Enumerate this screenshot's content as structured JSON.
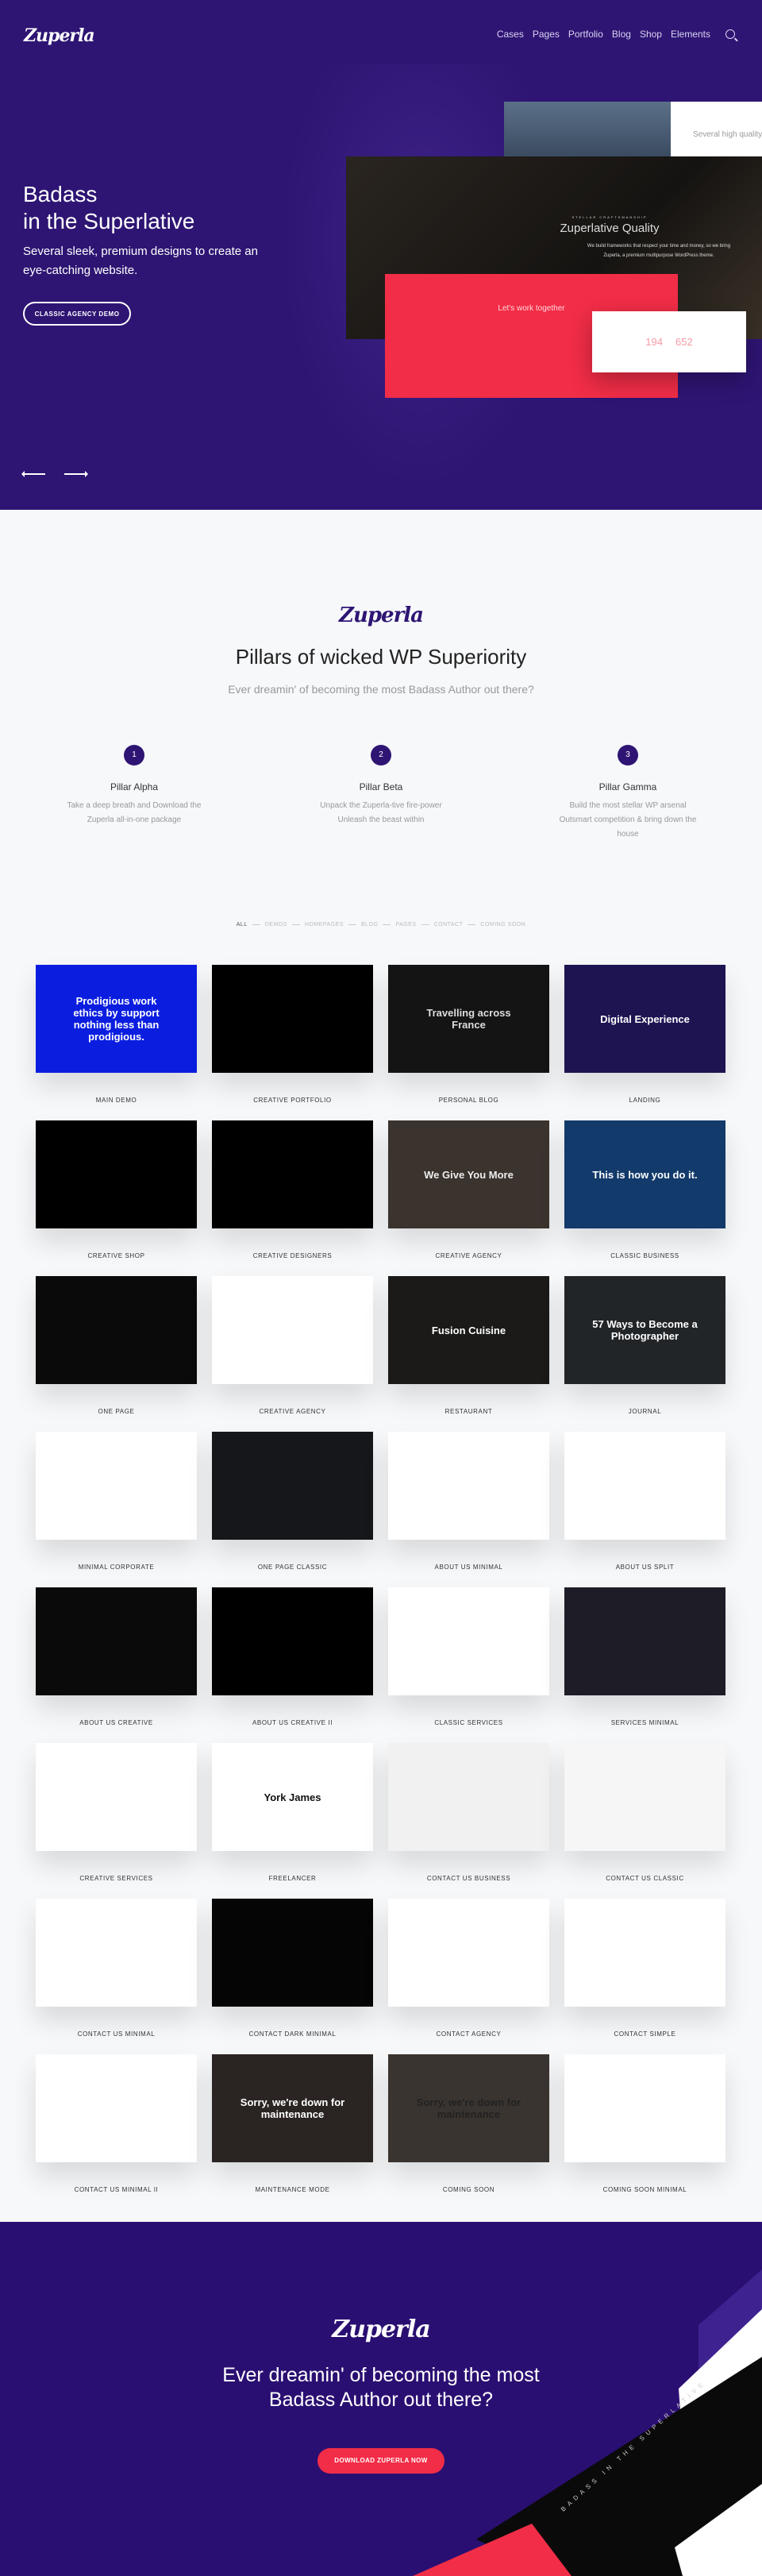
{
  "header": {
    "logo": "Zuperla",
    "nav": [
      "Cases",
      "Pages",
      "Portfolio",
      "Blog",
      "Shop",
      "Elements"
    ]
  },
  "hero": {
    "title_line1": "Badass",
    "title_line2": "in the Superlative",
    "subtitle": "Several sleek, premium designs to create an eye-catching website.",
    "button": "CLASSIC AGENCY DEMO",
    "mockups": {
      "top_text": "Several high quality",
      "dark_kicker": "STELLAR CRAFTSMANSHIP",
      "dark_title": "Zuperlative Quality",
      "dark_desc": "We build frameworks that respect your time and money, so we bring Zuperla, a premium multipurpose WordPress theme.",
      "red_title": "Let's work together",
      "stat1": "194",
      "stat2": "652"
    }
  },
  "pillars": {
    "logo": "Zuperla",
    "title": "Pillars of wicked WP Superiority",
    "subtitle": "Ever dreamin' of becoming the most Badass Author out there?",
    "items": [
      {
        "num": "1",
        "name": "Pillar Alpha",
        "desc": "Take a deep breath and Download the Zuperla all-in-one package"
      },
      {
        "num": "2",
        "name": "Pillar Beta",
        "desc": "Unpack the Zuperla-tive fire-power Unleash the beast within"
      },
      {
        "num": "3",
        "name": "Pillar Gamma",
        "desc": "Build the most stellar WP arsenal Outsmart competition & bring down the house"
      }
    ]
  },
  "filters": [
    "ALL",
    "DEMOS",
    "HOMEPAGES",
    "BLOG",
    "PAGES",
    "CONTACT",
    "COMING SOON"
  ],
  "demos": [
    {
      "label": "MAIN DEMO",
      "headline": "Prodigious work ethics by support nothing less than prodigious.",
      "bg": "#0b1ee0",
      "fg": "#ffffff"
    },
    {
      "label": "CREATIVE PORTFOLIO",
      "headline": "",
      "bg": "#000000",
      "fg": "#ffffff"
    },
    {
      "label": "PERSONAL BLOG",
      "headline": "Travelling across France",
      "bg": "#141414",
      "fg": "#dddddd"
    },
    {
      "label": "LANDING",
      "headline": "Digital Experience",
      "bg": "#1e1452",
      "fg": "#ffffff"
    },
    {
      "label": "CREATIVE SHOP",
      "headline": "",
      "bg": "#000000",
      "fg": "#ffffff"
    },
    {
      "label": "CREATIVE DESIGNERS",
      "headline": "",
      "bg": "#000000",
      "fg": "#ffffff"
    },
    {
      "label": "CREATIVE AGENCY",
      "headline": "We Give You More",
      "bg": "#3a332e",
      "fg": "#eeeeee"
    },
    {
      "label": "CLASSIC BUSINESS",
      "headline": "This is how you do it.",
      "bg": "#123a6a",
      "fg": "#ffffff"
    },
    {
      "label": "ONE PAGE",
      "headline": "",
      "bg": "#0a0a0a",
      "fg": "#ffffff"
    },
    {
      "label": "CREATIVE AGENCY",
      "headline": "",
      "bg": "#ffffff",
      "fg": "#333333"
    },
    {
      "label": "RESTAURANT",
      "headline": "Fusion Cuisine",
      "bg": "#1b1a18",
      "fg": "#ffffff"
    },
    {
      "label": "JOURNAL",
      "headline": "57 Ways to Become a Photographer",
      "bg": "#222528",
      "fg": "#ffffff"
    },
    {
      "label": "MINIMAL CORPORATE",
      "headline": "",
      "bg": "#ffffff",
      "fg": "#333333"
    },
    {
      "label": "ONE PAGE CLASSIC",
      "headline": "",
      "bg": "#16171b",
      "fg": "#ffffff"
    },
    {
      "label": "ABOUT US MINIMAL",
      "headline": "",
      "bg": "#ffffff",
      "fg": "#333333"
    },
    {
      "label": "ABOUT US SPLIT",
      "headline": "",
      "bg": "#ffffff",
      "fg": "#333333"
    },
    {
      "label": "ABOUT US CREATIVE",
      "headline": "",
      "bg": "#0a0a0a",
      "fg": "#ffffff"
    },
    {
      "label": "ABOUT US CREATIVE II",
      "headline": "",
      "bg": "#000000",
      "fg": "#ffffff"
    },
    {
      "label": "CLASSIC SERVICES",
      "headline": "",
      "bg": "#ffffff",
      "fg": "#333333"
    },
    {
      "label": "SERVICES MINIMAL",
      "headline": "",
      "bg": "#1e1c26",
      "fg": "#ffffff"
    },
    {
      "label": "CREATIVE SERVICES",
      "headline": "",
      "bg": "#ffffff",
      "fg": "#333333"
    },
    {
      "label": "FREELANCER",
      "headline": "York James",
      "bg": "#ffffff",
      "fg": "#111111"
    },
    {
      "label": "CONTACT US BUSINESS",
      "headline": "",
      "bg": "#f1f1f1",
      "fg": "#333333"
    },
    {
      "label": "CONTACT US CLASSIC",
      "headline": "",
      "bg": "#f6f6f6",
      "fg": "#333333"
    },
    {
      "label": "CONTACT US MINIMAL",
      "headline": "",
      "bg": "#ffffff",
      "fg": "#333333"
    },
    {
      "label": "CONTACT DARK MINIMAL",
      "headline": "",
      "bg": "#050505",
      "fg": "#ffffff"
    },
    {
      "label": "CONTACT AGENCY",
      "headline": "",
      "bg": "#ffffff",
      "fg": "#333333"
    },
    {
      "label": "CONTACT SIMPLE",
      "headline": "",
      "bg": "#ffffff",
      "fg": "#333333"
    },
    {
      "label": "CONTACT US MINIMAL II",
      "headline": "",
      "bg": "#ffffff",
      "fg": "#333333"
    },
    {
      "label": "MAINTENANCE MODE",
      "headline": "Sorry, we're down for maintenance",
      "bg": "#2a2523",
      "fg": "#ffffff"
    },
    {
      "label": "COMING SOON",
      "headline": "Sorry, we're down for maintenance",
      "bg": "#3a3430",
      "fg": "#222222"
    },
    {
      "label": "COMING SOON MINIMAL",
      "headline": "",
      "bg": "#ffffff",
      "fg": "#333333"
    }
  ],
  "cta": {
    "logo": "Zuperla",
    "title": "Ever dreamin' of becoming the most Badass Author out there?",
    "button": "DOWNLOAD ZUPERLA NOW",
    "mockup_text": "BADASS IN THE SUPERLATIVE"
  },
  "colors": {
    "brand": "#2e1573",
    "accent": "#f22d47",
    "background": "#f7f8fa"
  }
}
